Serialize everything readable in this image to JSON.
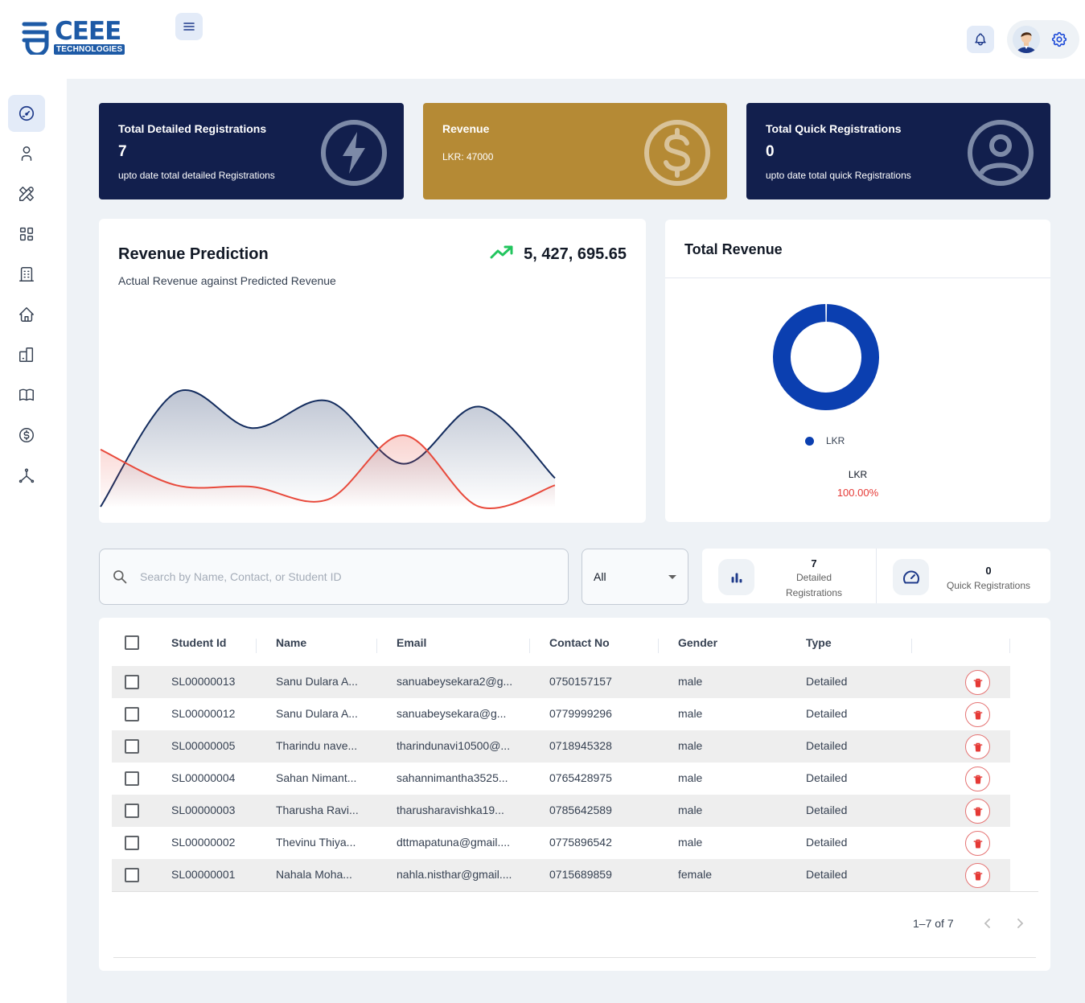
{
  "brand": {
    "name": "CEEE",
    "subtitle": "TECHNOLOGIES"
  },
  "colors": {
    "primary": "#0b3fb0",
    "navy": "#121f4d",
    "gold": "#b58a35",
    "danger": "#e53935",
    "actual_line": "#132c5e",
    "predicted_line": "#e84a3c"
  },
  "header": {
    "menu_icon": "hamburger-icon",
    "notification_icon": "bell-icon",
    "settings_icon": "gear-icon"
  },
  "sidebar": {
    "items": [
      {
        "icon": "dashboard-gauge-icon",
        "active": true
      },
      {
        "icon": "user-icon"
      },
      {
        "icon": "tools-icon"
      },
      {
        "icon": "layout-icon"
      },
      {
        "icon": "building-icon"
      },
      {
        "icon": "home-icon"
      },
      {
        "icon": "devices-icon"
      },
      {
        "icon": "book-icon"
      },
      {
        "icon": "currency-icon"
      },
      {
        "icon": "hierarchy-icon"
      }
    ]
  },
  "stats": {
    "detailed": {
      "title": "Total Detailed Registrations",
      "value": "7",
      "subtitle": "upto date total detailed Registrations",
      "icon": "bolt-icon"
    },
    "revenue": {
      "title": "Revenue",
      "subtitle": "LKR: 47000",
      "icon": "dollar-icon"
    },
    "quick": {
      "title": "Total Quick Registrations",
      "value": "0",
      "subtitle": "upto date total quick Registrations",
      "icon": "user-circle-icon"
    }
  },
  "revenue_prediction": {
    "title": "Revenue Prediction",
    "subtitle": "Actual Revenue against Predicted Revenue",
    "value": "5, 427, 695.65",
    "trend_icon": "trending-up-icon"
  },
  "total_revenue": {
    "title": "Total Revenue",
    "legend": "LKR",
    "label": "LKR",
    "percent": "100.00%"
  },
  "chart_data": [
    {
      "type": "area",
      "title": "Revenue Prediction",
      "xlabel": "",
      "ylabel": "",
      "x": [
        0,
        1,
        2,
        3,
        4,
        5,
        6
      ],
      "series": [
        {
          "values": [
            0,
            160,
            110,
            148,
            60,
            140,
            40
          ]
        },
        {
          "values": [
            80,
            30,
            28,
            10,
            100,
            0,
            30
          ]
        }
      ],
      "ylim": [
        0,
        180
      ],
      "grid": false
    },
    {
      "type": "pie",
      "title": "Total Revenue",
      "categories": [
        "LKR"
      ],
      "values": [
        100
      ],
      "donut": true
    }
  ],
  "filters": {
    "search_placeholder": "Search by Name, Contact, or Student ID",
    "search_value": "",
    "select_value": "All"
  },
  "counts": {
    "detailed": {
      "value": "7",
      "label_line1": "Detailed",
      "label_line2": "Registrations",
      "icon": "bar-chart-icon"
    },
    "quick": {
      "value": "0",
      "label": "Quick Registrations",
      "icon": "speedometer-icon"
    }
  },
  "table": {
    "columns": [
      "Student Id",
      "Name",
      "Email",
      "Contact No",
      "Gender",
      "Type"
    ],
    "rows": [
      {
        "id": "SL00000013",
        "name": "Sanu Dulara A...",
        "email": "sanuabeysekara2@g...",
        "contact": "0750157157",
        "gender": "male",
        "type": "Detailed"
      },
      {
        "id": "SL00000012",
        "name": "Sanu Dulara A...",
        "email": "sanuabeysekara@g...",
        "contact": "0779999296",
        "gender": "male",
        "type": "Detailed"
      },
      {
        "id": "SL00000005",
        "name": "Tharindu nave...",
        "email": "tharindunavi10500@...",
        "contact": "0718945328",
        "gender": "male",
        "type": "Detailed"
      },
      {
        "id": "SL00000004",
        "name": "Sahan Nimant...",
        "email": "sahannimantha3525...",
        "contact": "0765428975",
        "gender": "male",
        "type": "Detailed"
      },
      {
        "id": "SL00000003",
        "name": "Tharusha Ravi...",
        "email": "tharusharavishka19...",
        "contact": "0785642589",
        "gender": "male",
        "type": "Detailed"
      },
      {
        "id": "SL00000002",
        "name": "Thevinu Thiya...",
        "email": "dttmapatuna@gmail....",
        "contact": "0775896542",
        "gender": "male",
        "type": "Detailed"
      },
      {
        "id": "SL00000001",
        "name": "Nahala Moha...",
        "email": "nahla.nisthar@gmail....",
        "contact": "0715689859",
        "gender": "female",
        "type": "Detailed"
      }
    ],
    "pagination": "1–7 of 7"
  }
}
